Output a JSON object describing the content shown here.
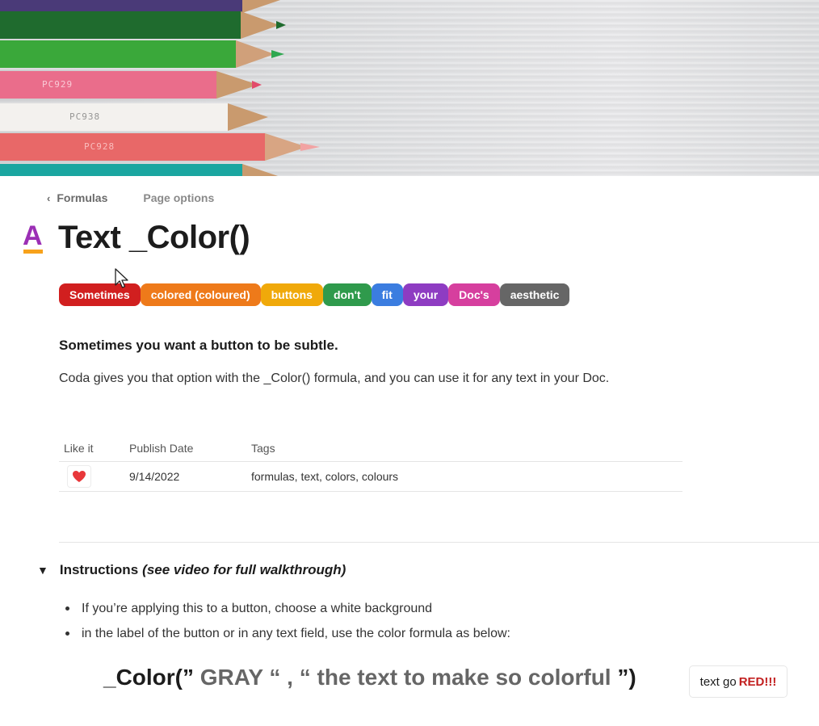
{
  "breadcrumb": {
    "back_label": "Formulas",
    "options_label": "Page options"
  },
  "title": {
    "icon": "text-color-icon",
    "text": "Text _Color()"
  },
  "pills": [
    {
      "label": "Sometimes",
      "color": "#d11f1f"
    },
    {
      "label": "colored (coloured)",
      "color": "#ee7a1a"
    },
    {
      "label": "buttons",
      "color": "#f0a90a"
    },
    {
      "label": "don't",
      "color": "#2f9a4c"
    },
    {
      "label": "fit",
      "color": "#3b7de0"
    },
    {
      "label": "your",
      "color": "#8e3cc2"
    },
    {
      "label": "Doc's",
      "color": "#d63f9e"
    },
    {
      "label": "aesthetic",
      "color": "#666666"
    }
  ],
  "subtitle": "Sometimes you want a button to be subtle.",
  "description": "Coda gives you that option with the _Color() formula, and you can use it for any text in your Doc.",
  "table": {
    "columns": [
      "Like it",
      "Publish Date",
      "Tags"
    ],
    "rows": [
      {
        "like_icon": "heart-icon",
        "date": "9/14/2022",
        "tags": "formulas, text, colors, colours"
      }
    ]
  },
  "instructions": {
    "title": "Instructions",
    "title_em": "(see video for full walkthrough)",
    "bullets": [
      "If you’re applying this to a button, choose a white background",
      "in the label of the button or in any text field, use the color formula as below:"
    ]
  },
  "formula": {
    "prefix": "_Color(”",
    "color_arg": "GRAY",
    "middle": "“ , “",
    "text_arg": "the text to make so colorful",
    "suffix": "”)"
  },
  "demo_button": {
    "label": "text go",
    "red_label": "RED!!!",
    "red_color": "#c21f1f"
  }
}
